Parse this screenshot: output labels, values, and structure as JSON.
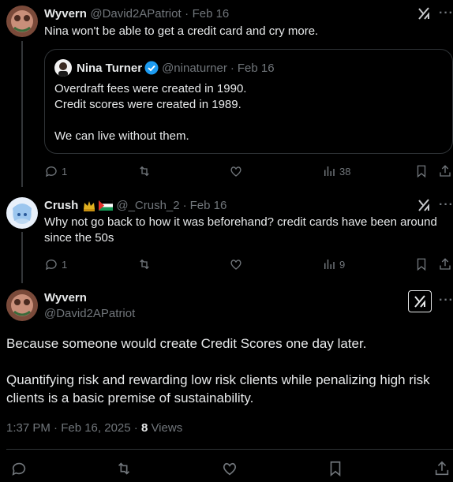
{
  "tweet1": {
    "name": "Wyvern",
    "handle": "@David2APatriot",
    "sep": "·",
    "date": "Feb 16",
    "text": "Nina won't be able to get a credit card and cry more.",
    "quote": {
      "name": "Nina Turner",
      "handle": "@ninaturner",
      "sep": "·",
      "date": "Feb 16",
      "line1": "Overdraft fees were created in 1990.",
      "line2": "Credit scores were created in 1989.",
      "line3": "We can live without them."
    },
    "replies": "1",
    "views": "38"
  },
  "tweet2": {
    "name": "Crush",
    "handle": "@_Crush_2",
    "sep": "·",
    "date": "Feb 16",
    "text": "Why not go back to how it was beforehand? credit cards have been around since the 50s",
    "replies": "1",
    "views": "9"
  },
  "main": {
    "name": "Wyvern",
    "handle": "@David2APatriot",
    "para1": "Because someone would create Credit Scores one day later.",
    "para2": "Quantifying risk and rewarding low risk clients while penalizing high risk clients is a basic premise of sustainability.",
    "time": "1:37 PM · Feb 16, 2025 · ",
    "views_count": "8",
    "views_label": " Views"
  },
  "colors": {
    "background": "#000000",
    "muted": "#71767b",
    "verified": "#1d9bf0",
    "border": "#2f3336"
  }
}
